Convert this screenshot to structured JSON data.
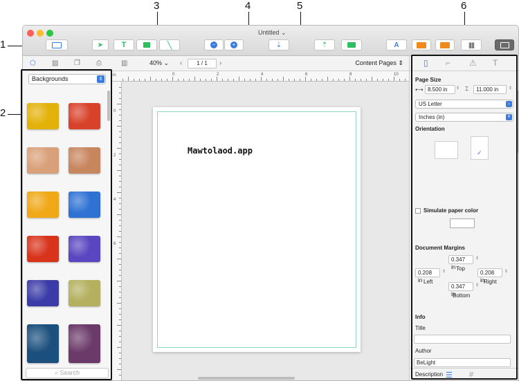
{
  "callouts": [
    "1",
    "2",
    "3",
    "4",
    "5",
    "6"
  ],
  "window": {
    "title": "Untitled"
  },
  "toolbar": {
    "zoom": "40%",
    "page_field": "1 / 1",
    "content_pages": "Content Pages",
    "page_prev": "‹",
    "page_next": "›"
  },
  "left_panel": {
    "category": "Backgrounds",
    "search_placeholder": "Search"
  },
  "thumbs": [
    {
      "name": "yellow-texture",
      "color": "#e3b20a"
    },
    {
      "name": "red-texture",
      "color": "#d8422a"
    },
    {
      "name": "speckled-texture",
      "color": "#d9a17a"
    },
    {
      "name": "copper-texture",
      "color": "#c8865f"
    },
    {
      "name": "gold-blue-texture",
      "color": "#f0a817"
    },
    {
      "name": "blue-texture",
      "color": "#2f72d4"
    },
    {
      "name": "orange-red-texture",
      "color": "#d8341c"
    },
    {
      "name": "purple-texture",
      "color": "#5a46c0"
    },
    {
      "name": "navy-gold-texture",
      "color": "#3c3ca8"
    },
    {
      "name": "olive-texture",
      "color": "#b4b060"
    },
    {
      "name": "dark-blue-texture",
      "color": "#1b4f7d"
    },
    {
      "name": "plum-texture",
      "color": "#6b3a69"
    }
  ],
  "ruler": {
    "unit": "in",
    "h_labels": [
      "0",
      "2",
      "4",
      "6",
      "8",
      "10"
    ],
    "v_labels": [
      "0",
      "2",
      "4",
      "6"
    ]
  },
  "page": {
    "text": "Mawtolaod.app"
  },
  "inspector": {
    "page_size_label": "Page Size",
    "width": "8.500 in",
    "height": "11.000 in",
    "paper": "US Letter",
    "units": "Inches (in)",
    "orientation_label": "Orientation",
    "check": "✓",
    "simulate_label": "Simulate paper color",
    "margins_label": "Document Margins",
    "margin_top": "0.347 in",
    "top_label": "Top",
    "margin_left": "0.208 in",
    "left_label": "Left",
    "margin_right": "0.208 in",
    "right_label": "Right",
    "margin_bottom": "0.347 in",
    "bottom_label": "Bottom",
    "info_label": "Info",
    "title_label": "Title",
    "title_value": "",
    "author_label": "Author",
    "author_value": "BeLight",
    "description_label": "Description"
  },
  "colors": {
    "accent": "#3a7be0",
    "margin_guide": "#8fd3cf",
    "orange": "#f08a1c"
  }
}
